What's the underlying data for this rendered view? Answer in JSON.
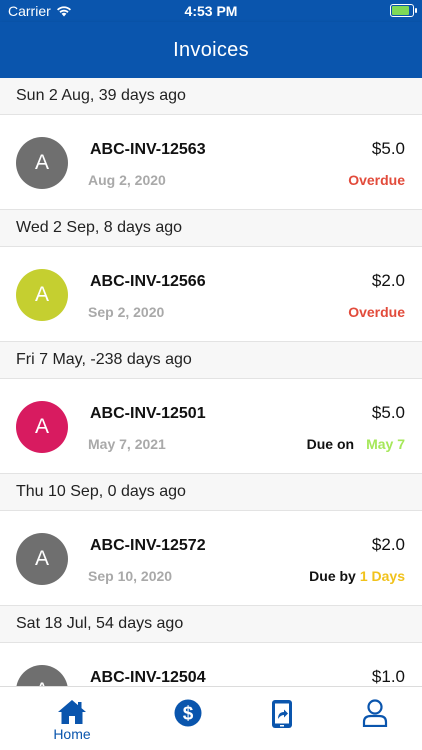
{
  "status_bar": {
    "carrier": "Carrier",
    "time": "4:53 PM"
  },
  "header": {
    "title": "Invoices"
  },
  "colors": {
    "brand": "#0a55ad",
    "overdue": "#e24b3b",
    "due_on_date": "#a6e85a",
    "due_by_days": "#f1c21b",
    "battery": "#7ed957"
  },
  "sections": [
    {
      "header": "Sun 2 Aug, 39 days ago",
      "invoice": {
        "initial": "A",
        "avatar_color": "#6f6f6f",
        "number": "ABC-INV-12563",
        "date": "Aug 2, 2020",
        "amount": "$5.0",
        "status_prefix": "",
        "status_value": "Overdue",
        "status_color": "#e24b3b"
      }
    },
    {
      "header": "Wed 2 Sep, 8 days ago",
      "invoice": {
        "initial": "A",
        "avatar_color": "#c5cf30",
        "number": "ABC-INV-12566",
        "date": "Sep 2, 2020",
        "amount": "$2.0",
        "status_prefix": "",
        "status_value": "Overdue",
        "status_color": "#e24b3b"
      }
    },
    {
      "header": "Fri 7 May, -238 days ago",
      "invoice": {
        "initial": "A",
        "avatar_color": "#d81b60",
        "number": "ABC-INV-12501",
        "date": "May 7, 2021",
        "amount": "$5.0",
        "status_prefix": "Due on",
        "status_value": "May 7",
        "status_color": "#a6e85a"
      }
    },
    {
      "header": "Thu 10 Sep, 0 days ago",
      "invoice": {
        "initial": "A",
        "avatar_color": "#6f6f6f",
        "number": "ABC-INV-12572",
        "date": "Sep 10, 2020",
        "amount": "$2.0",
        "status_prefix": "Due by",
        "status_value": "1 Days",
        "status_color": "#f1c21b"
      }
    },
    {
      "header": "Sat 18 Jul, 54 days ago",
      "invoice": {
        "initial": "A",
        "avatar_color": "#6f6f6f",
        "number": "ABC-INV-12504",
        "date": "",
        "amount": "$1.0",
        "status_prefix": "",
        "status_value": "",
        "status_color": "#e24b3b"
      }
    }
  ],
  "tab_bar": {
    "items": [
      {
        "label": "Home",
        "icon": "home-icon"
      },
      {
        "label": "",
        "icon": "dollar-circle-icon"
      },
      {
        "label": "",
        "icon": "phone-share-icon"
      },
      {
        "label": "",
        "icon": "user-icon"
      }
    ]
  }
}
